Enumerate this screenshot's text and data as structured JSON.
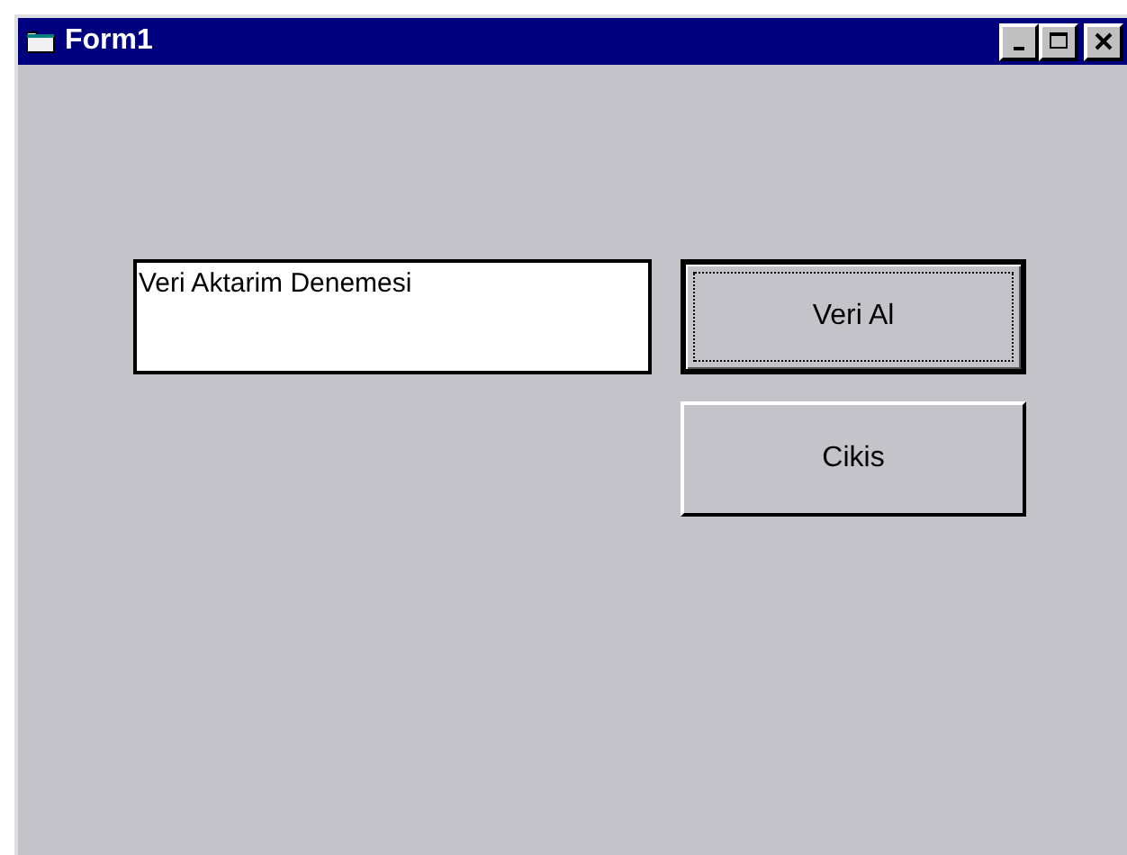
{
  "window": {
    "title": "Form1",
    "controls": [
      {
        "kind": "minimize"
      },
      {
        "kind": "maximize"
      },
      {
        "kind": "close"
      }
    ]
  },
  "textbox": {
    "value": "Veri Aktarim Denemesi"
  },
  "buttons": [
    {
      "label": "Veri Al",
      "focused": true
    },
    {
      "label": "Cikis",
      "focused": false
    }
  ]
}
